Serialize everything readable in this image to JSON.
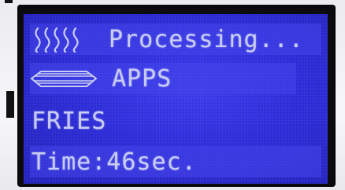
{
  "display": {
    "status": "Processing...",
    "program": "APPS",
    "item": "FRIES",
    "time": "Time:46sec."
  },
  "icons": {
    "heat": "heat-waves-icon",
    "tray": "tray-icon"
  },
  "colors": {
    "lcd_background": "#2d2dd9",
    "lcd_text": "#c9cdf4",
    "bezel": "#0c0c10"
  }
}
